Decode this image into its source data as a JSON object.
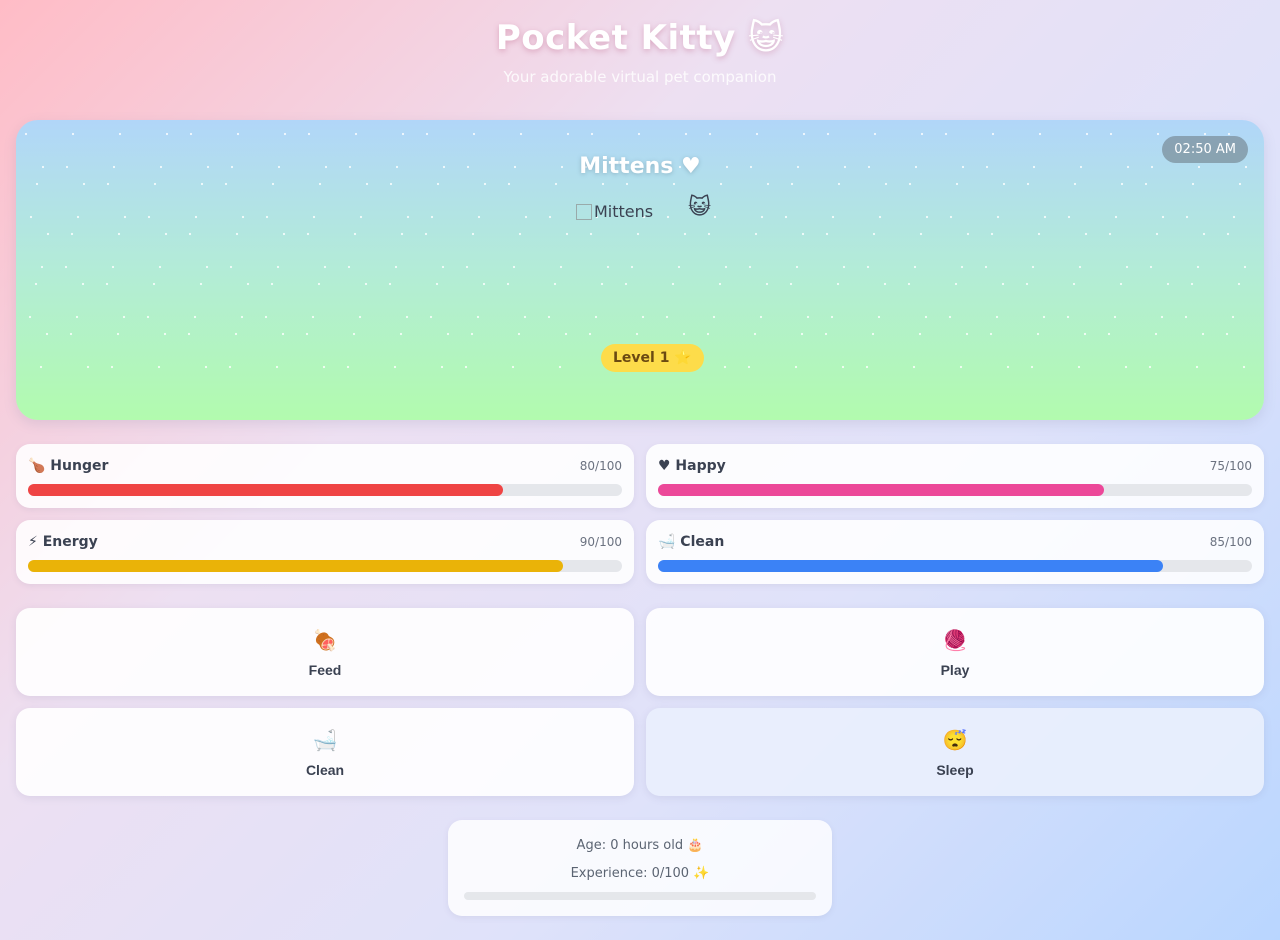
{
  "header": {
    "title": "Pocket Kitty 😺",
    "subtitle": "Your adorable virtual pet companion"
  },
  "stage": {
    "clock": "02:50 AM",
    "pet_name": "Mittens ♥",
    "pet_image_alt": "Mittens",
    "pet_emoji": "😺",
    "level": "Level 1 ⭐"
  },
  "stats": [
    {
      "label": "🍗 Hunger",
      "value_text": "80/100",
      "value": 80,
      "color": "#ef4444"
    },
    {
      "label": "♥ Happy",
      "value_text": "75/100",
      "value": 75,
      "color": "#ec4899"
    },
    {
      "label": "⚡ Energy",
      "value_text": "90/100",
      "value": 90,
      "color": "#eab308"
    },
    {
      "label": "🛁 Clean",
      "value_text": "85/100",
      "value": 85,
      "color": "#3b82f6"
    }
  ],
  "actions": [
    {
      "icon": "🍖",
      "label": "Feed"
    },
    {
      "icon": "🧶",
      "label": "Play"
    },
    {
      "icon": "🛁",
      "label": "Clean"
    },
    {
      "icon": "😴",
      "label": "Sleep"
    }
  ],
  "info": {
    "age": "Age: 0 hours old 🎂",
    "experience": "Experience: 0/100 ✨",
    "xp_progress": 0
  }
}
